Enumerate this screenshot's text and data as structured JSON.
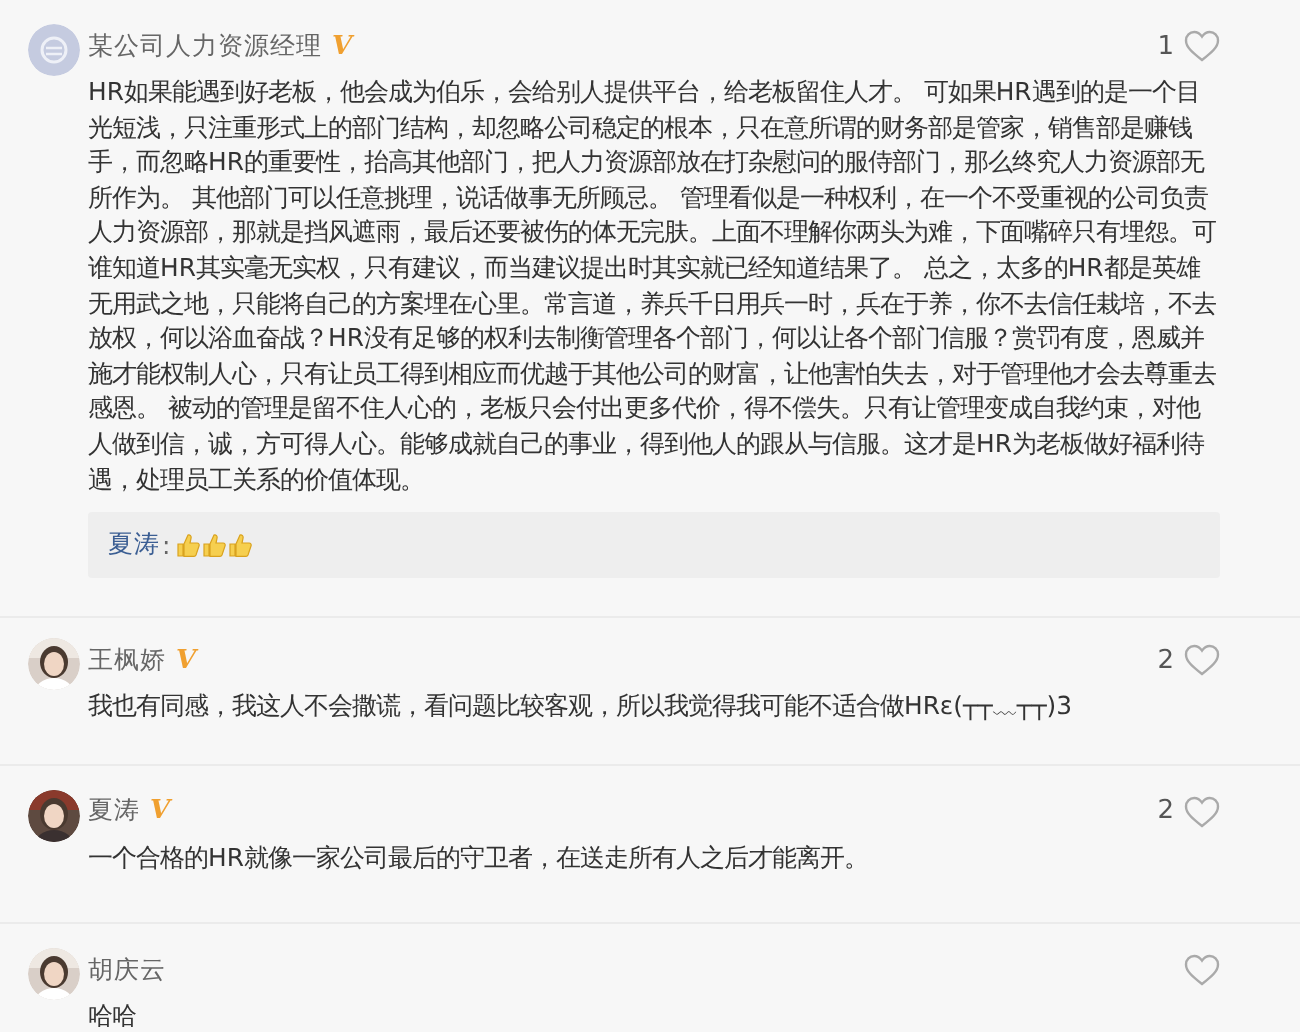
{
  "comments": [
    {
      "avatar": {
        "kind": "default"
      },
      "name": "某公司人力资源经理",
      "badge": "V",
      "likes": "1",
      "text": "HR如果能遇到好老板，他会成为伯乐，会给别人提供平台，给老板留住人才。 可如果HR遇到的是一个目光短浅，只注重形式上的部门结构，却忽略公司稳定的根本，只在意所谓的财务部是管家，销售部是赚钱手，而忽略HR的重要性，抬高其他部门，把人力资源部放在打杂慰问的服侍部门，那么终究人力资源部无所作为。 其他部门可以任意挑理，说话做事无所顾忌。 管理看似是一种权利，在一个不受重视的公司负责人力资源部，那就是挡风遮雨，最后还要被伤的体无完肤。上面不理解你两头为难，下面嘴碎只有埋怨。可谁知道HR其实毫无实权，只有建议，而当建议提出时其实就已经知道结果了。 总之，太多的HR都是英雄无用武之地，只能将自己的方案埋在心里。常言道，养兵千日用兵一时，兵在于养，你不去信任栽培，不去放权，何以浴血奋战？HR没有足够的权利去制衡管理各个部门，何以让各个部门信服？赏罚有度，恩威并施才能权制人心，只有让员工得到相应而优越于其他公司的财富，让他害怕失去，对于管理他才会去尊重去感恩。 被动的管理是留不住人心的，老板只会付出更多代价，得不偿失。只有让管理变成自我约束，对他人做到信，诚，方可得人心。能够成就自己的事业，得到他人的跟从与信服。这才是HR为老板做好福利待遇，处理员工关系的价值体现。",
      "replies": [
        {
          "name": "夏涛",
          "sep": ":",
          "emoji": [
            {
              "kind": "thumbs-up"
            },
            {
              "kind": "thumbs-up"
            },
            {
              "kind": "thumbs-up"
            }
          ]
        }
      ]
    },
    {
      "name": "王枫娇",
      "badge": "V",
      "likes": "2",
      "text": "我也有同感，我这人不会撒谎，看问题比较客观，所以我觉得我可能不适合做HRε(┬┬﹏┬┬)3"
    },
    {
      "name": "夏涛",
      "badge": "V",
      "likes": "2",
      "text": "一个合格的HR就像一家公司最后的守卫者，在送走所有人之后才能离开。"
    },
    {
      "name": "胡庆云",
      "text": "哈哈"
    }
  ]
}
